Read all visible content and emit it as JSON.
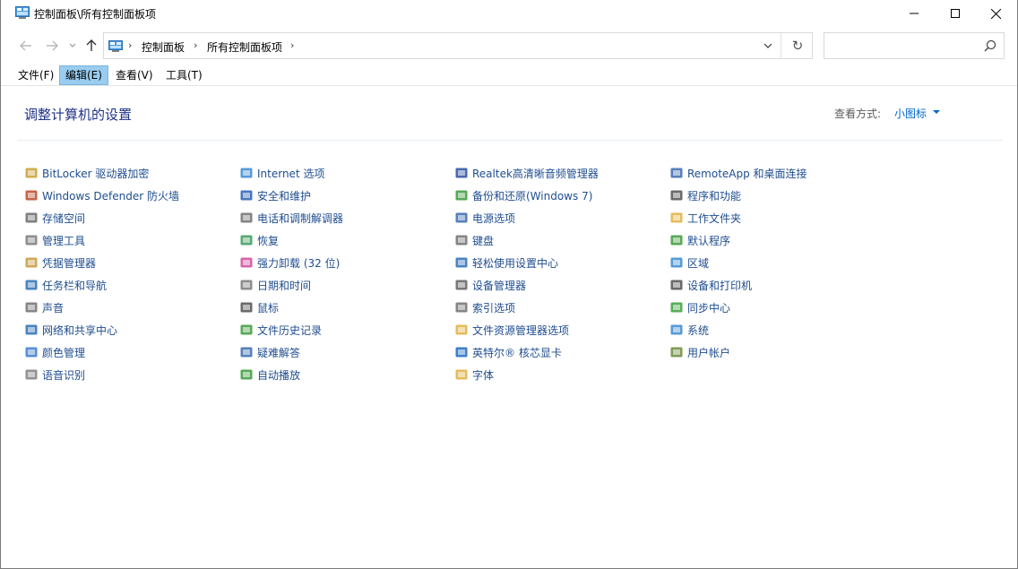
{
  "window": {
    "title": "控制面板\\所有控制面板项",
    "minimize_icon": "minimize-icon",
    "maximize_icon": "maximize-icon",
    "close_icon": "close-icon"
  },
  "address_bar": {
    "crumbs": [
      "控制面板",
      "所有控制面板项"
    ],
    "separator": "›",
    "refresh_glyph": "↻",
    "search_value": "",
    "search_placeholder": ""
  },
  "menubar": {
    "items": [
      {
        "label": "文件(F)",
        "active": false
      },
      {
        "label": "编辑(E)",
        "active": true
      },
      {
        "label": "查看(V)",
        "active": false
      },
      {
        "label": "工具(T)",
        "active": false
      }
    ]
  },
  "header": {
    "title": "调整计算机的设置",
    "view_by_label": "查看方式:",
    "view_by_value": "小图标"
  },
  "columns": [
    [
      {
        "label": "BitLocker 驱动器加密",
        "icon": "bitlocker-icon",
        "color": "#c8a030"
      },
      {
        "label": "Windows Defender 防火墙",
        "icon": "firewall-icon",
        "color": "#b84a2a"
      },
      {
        "label": "存储空间",
        "icon": "storage-icon",
        "color": "#6a6a6a"
      },
      {
        "label": "管理工具",
        "icon": "admin-tools-icon",
        "color": "#7a7a7a"
      },
      {
        "label": "凭据管理器",
        "icon": "credential-icon",
        "color": "#c79a3a"
      },
      {
        "label": "任务栏和导航",
        "icon": "taskbar-icon",
        "color": "#2a6fb5"
      },
      {
        "label": "声音",
        "icon": "sound-icon",
        "color": "#707070"
      },
      {
        "label": "网络和共享中心",
        "icon": "network-icon",
        "color": "#2a6fb5"
      },
      {
        "label": "颜色管理",
        "icon": "color-management-icon",
        "color": "#3a7ad0"
      },
      {
        "label": "语音识别",
        "icon": "microphone-icon",
        "color": "#808080"
      }
    ],
    [
      {
        "label": "Internet 选项",
        "icon": "internet-options-icon",
        "color": "#3a8ad0"
      },
      {
        "label": "安全和维护",
        "icon": "flag-icon",
        "color": "#2a5fb5"
      },
      {
        "label": "电话和调制解调器",
        "icon": "phone-modem-icon",
        "color": "#707070"
      },
      {
        "label": "恢复",
        "icon": "recovery-icon",
        "color": "#3a9a5a"
      },
      {
        "label": "强力卸载 (32 位)",
        "icon": "uninstall-icon",
        "color": "#d04a9a"
      },
      {
        "label": "日期和时间",
        "icon": "clock-icon",
        "color": "#7a7a7a"
      },
      {
        "label": "鼠标",
        "icon": "mouse-icon",
        "color": "#505050"
      },
      {
        "label": "文件历史记录",
        "icon": "file-history-icon",
        "color": "#3a9a3a"
      },
      {
        "label": "疑难解答",
        "icon": "troubleshoot-icon",
        "color": "#3a6ab0"
      },
      {
        "label": "自动播放",
        "icon": "autoplay-icon",
        "color": "#3a9a3a"
      }
    ],
    [
      {
        "label": "Realtek高清晰音频管理器",
        "icon": "realtek-audio-icon",
        "color": "#2a4fa0"
      },
      {
        "label": "备份和还原(Windows 7)",
        "icon": "backup-icon",
        "color": "#3a9a3a"
      },
      {
        "label": "电源选项",
        "icon": "power-icon",
        "color": "#3a6ab0"
      },
      {
        "label": "键盘",
        "icon": "keyboard-icon",
        "color": "#707070"
      },
      {
        "label": "轻松使用设置中心",
        "icon": "ease-of-access-icon",
        "color": "#2a6fb5"
      },
      {
        "label": "设备管理器",
        "icon": "device-manager-icon",
        "color": "#606060"
      },
      {
        "label": "索引选项",
        "icon": "indexing-icon",
        "color": "#707070"
      },
      {
        "label": "文件资源管理器选项",
        "icon": "folder-options-icon",
        "color": "#e0b040"
      },
      {
        "label": "英特尔® 核芯显卡",
        "icon": "intel-graphics-icon",
        "color": "#1a6ac0"
      },
      {
        "label": "字体",
        "icon": "font-icon",
        "color": "#e0b040"
      }
    ],
    [
      {
        "label": "RemoteApp 和桌面连接",
        "icon": "remoteapp-icon",
        "color": "#3a6ab0"
      },
      {
        "label": "程序和功能",
        "icon": "programs-icon",
        "color": "#505050"
      },
      {
        "label": "工作文件夹",
        "icon": "work-folders-icon",
        "color": "#e0b040"
      },
      {
        "label": "默认程序",
        "icon": "default-programs-icon",
        "color": "#3a9a3a"
      },
      {
        "label": "区域",
        "icon": "region-icon",
        "color": "#3a8ad0"
      },
      {
        "label": "设备和打印机",
        "icon": "printer-icon",
        "color": "#505050"
      },
      {
        "label": "同步中心",
        "icon": "sync-icon",
        "color": "#3aa03a"
      },
      {
        "label": "系统",
        "icon": "system-icon",
        "color": "#3a8ad0"
      },
      {
        "label": "用户帐户",
        "icon": "user-accounts-icon",
        "color": "#6a8a3a"
      }
    ]
  ]
}
